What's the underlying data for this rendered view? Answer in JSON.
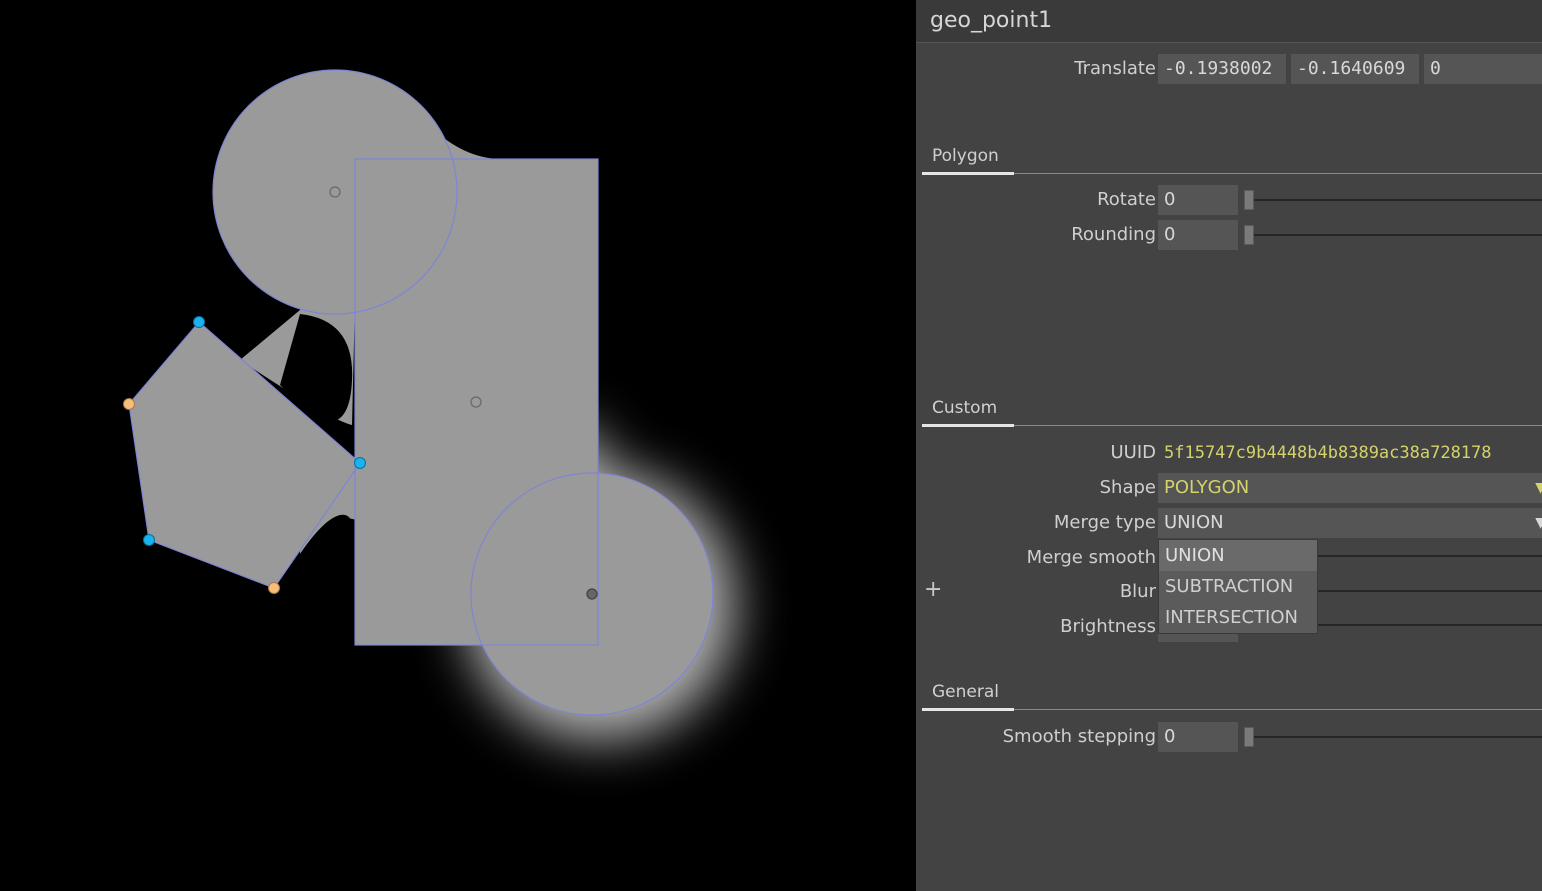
{
  "node": {
    "title": "geo_point1"
  },
  "translate": {
    "label": "Translate",
    "x": "-0.1938002",
    "y": "-0.1640609",
    "z": "0"
  },
  "sections": {
    "polygon": "Polygon",
    "custom": "Custom",
    "general": "General"
  },
  "polygon": {
    "rotate": {
      "label": "Rotate",
      "value": "0"
    },
    "rounding": {
      "label": "Rounding",
      "value": "0"
    }
  },
  "custom": {
    "uuid_label": "UUID",
    "uuid_value": "5f15747c9b4448b4b8389ac38a728178",
    "shape": {
      "label": "Shape",
      "value": "POLYGON"
    },
    "merge_type": {
      "label": "Merge type",
      "value": "UNION",
      "options": [
        "UNION",
        "SUBTRACTION",
        "INTERSECTION"
      ]
    },
    "merge_smooth_label": "Merge smooth",
    "blur_label": "Blur",
    "brightness_label": "Brightness",
    "add_symbol": "+"
  },
  "general": {
    "smooth_stepping": {
      "label": "Smooth stepping",
      "value": "0"
    }
  },
  "colors": {
    "shape_fill": "#9a9a9a",
    "outline": "#7d85d6",
    "handle_blue": "#19b4f0",
    "handle_orange": "#f7be7a",
    "uuid_yellow": "#d4d26a"
  }
}
